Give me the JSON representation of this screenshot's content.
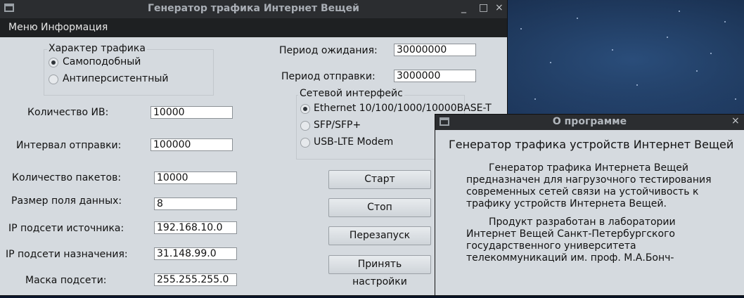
{
  "main_window": {
    "title": "Генератор трафика Интернет Вещей",
    "menu": [
      "Меню",
      "Информация"
    ],
    "traffic_group": {
      "title": "Характер трафика",
      "options": [
        "Самоподобный",
        "Антиперсистентный"
      ]
    },
    "fields": {
      "iv_count": {
        "label": "Количество ИВ:",
        "value": "10000"
      },
      "send_interval": {
        "label": "Интервал отправки:",
        "value": "100000"
      },
      "packet_count": {
        "label": "Количество пакетов:",
        "value": "10000"
      },
      "data_size": {
        "label": "Размер поля данных:",
        "value": "8"
      },
      "src_subnet": {
        "label": "IP подсети источника:",
        "value": "192.168.10.0"
      },
      "dst_subnet": {
        "label": "IP подсети назначения:",
        "value": "31.148.99.0"
      },
      "mask": {
        "label": "Маска подсети:",
        "value": "255.255.255.0"
      },
      "wait_period": {
        "label": "Период ожидания:",
        "value": "30000000"
      },
      "send_period": {
        "label": "Период отправки:",
        "value": "3000000"
      }
    },
    "iface_group": {
      "title": "Сетевой интерфейс",
      "options": [
        "Ethernet 10/100/1000/10000BASE-T",
        "SFP/SFP+",
        "USB-LTE Modem"
      ]
    },
    "buttons": {
      "start": "Старт",
      "stop": "Стоп",
      "restart": "Перезапуск",
      "apply": "Принять настройки"
    }
  },
  "about_window": {
    "title": "О программе",
    "heading": "Генератор трафика устройств Интернет Вещей",
    "para1": [
      "Генератор трафика Интернета Вещей",
      "предназначен для нагрузочного тестирования",
      "современных сетей связи на устойчивость к",
      "трафику устройств Интернета Вещей."
    ],
    "para2": [
      "Продукт разработан в лаборатории",
      "Интернет Вещей Санкт-Петербургского",
      "государственного университета",
      "телекоммуникаций им. проф. М.А.Бонч-"
    ]
  }
}
